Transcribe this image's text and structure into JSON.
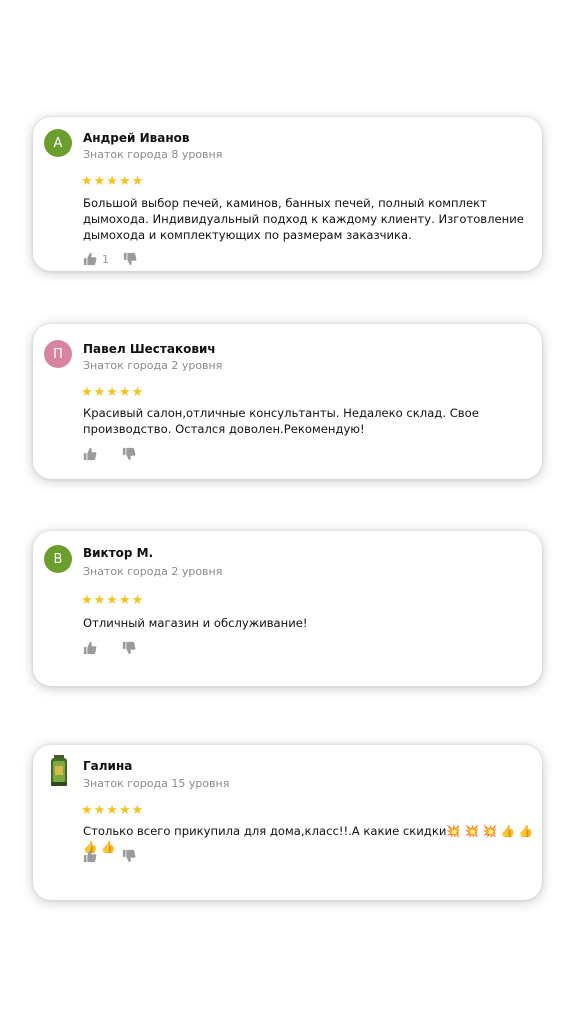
{
  "reviews": [
    {
      "avatar_letter": "А",
      "avatar_color": "#6a9e2d",
      "name": "Андрей Иванов",
      "level": "Знаток города 8 уровня",
      "stars": "★★★★★",
      "text": "Большой выбор печей, каминов, банных печей, полный комплект дымохода. Индивидуальный подход к каждому клиенту. Изготовление дымохода и комплектующих по размерам заказчика.",
      "likes": "1",
      "dislikes": ""
    },
    {
      "avatar_letter": "П",
      "avatar_color": "#d784a3",
      "name": "Павел Шестакович",
      "level": "Знаток города 2 уровня",
      "stars": "★★★★★",
      "text": "Красивый салон,отличные консультанты. Недалеко склад. Свое производство. Остался доволен.Рекомендую!",
      "likes": "",
      "dislikes": ""
    },
    {
      "avatar_letter": "В",
      "avatar_color": "#6a9e2d",
      "name": "Виктор М.",
      "level": "Знаток города 2 уровня",
      "stars": "★★★★★",
      "text": "Отличный магазин и обслуживание!",
      "likes": "",
      "dislikes": ""
    },
    {
      "avatar_letter": "",
      "avatar_color": "#ffffff",
      "name": "Галина",
      "level": "Знаток города 15 уровня",
      "stars": "★★★★★",
      "text": "Столько всего прикупила для дома,класс!!.А какие скидки💥 💥 💥 👍 👍 👍 👍",
      "likes": "",
      "dislikes": ""
    }
  ],
  "colors": {
    "star": "#f7c31b",
    "muted": "#8a8a8a",
    "icon": "#9a9a9a"
  }
}
